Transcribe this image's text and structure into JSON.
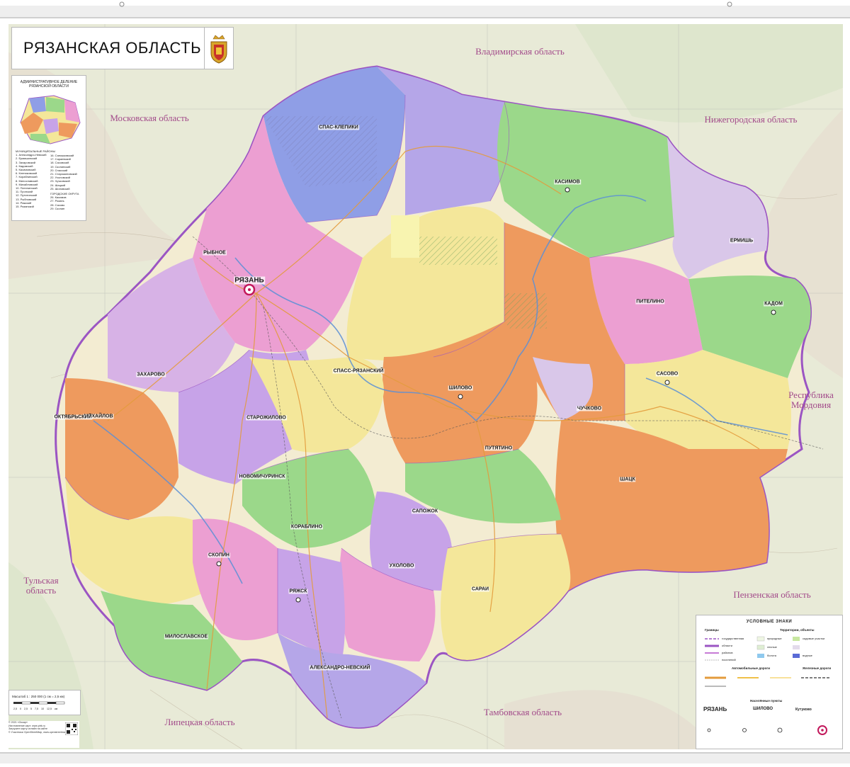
{
  "title": "РЯЗАНСКАЯ ОБЛАСТЬ",
  "inset": {
    "heading": "АДМИНИСТРАТИВНОЕ ДЕЛЕНИЕ РЯЗАНСКОЙ ОБЛАСТИ",
    "col1_header": "МУНИЦИПАЛЬНЫЕ РАЙОНЫ",
    "col1": [
      "1. Александро-Невский",
      "2. Ермишинский",
      "3. Захаровский",
      "4. Кадомский",
      "5. Касимовский",
      "6. Клепиковский",
      "7. Кораблинский",
      "8. Милославский",
      "9. Михайловский",
      "10. Пителинский",
      "11. Пронский",
      "12. Путятинский",
      "13. Рыбновский",
      "14. Ряжский",
      "15. Рязанский"
    ],
    "col2": [
      "16. Сапожковский",
      "17. Сараевский",
      "18. Сасовский",
      "19. Скопинский",
      "20. Спасский",
      "21. Старожиловский",
      "22. Ухоловский",
      "23. Чучковский",
      "24. Шацкий",
      "25. Шиловский"
    ],
    "col2_header": "ГОРОДСКИЕ ОКРУГА",
    "col2b": [
      "26. Касимов",
      "27. Рязань",
      "28. Сасово",
      "29. Скопин"
    ]
  },
  "neighbors": [
    {
      "name": "Владимирская область"
    },
    {
      "name": "Московская область"
    },
    {
      "name": "Нижегородская область"
    },
    {
      "name": "Республика Мордовия"
    },
    {
      "name": "Тульская область"
    },
    {
      "name": "Пензенская область"
    },
    {
      "name": "Тамбовская область"
    },
    {
      "name": "Липецкая область"
    }
  ],
  "cities": [
    {
      "name": "РЯЗАНЬ",
      "capital": true
    },
    {
      "name": "КАСИМОВ"
    },
    {
      "name": "САСОВО"
    },
    {
      "name": "СКОПИН"
    },
    {
      "name": "РЫБНОЕ"
    },
    {
      "name": "СПАСС-РЯЗАНСКИЙ"
    },
    {
      "name": "ШИЛОВО"
    },
    {
      "name": "РЯЖСК"
    },
    {
      "name": "НОВОМИЧУРИНСК"
    },
    {
      "name": "КОРАБЛИНО"
    },
    {
      "name": "САПОЖОК"
    },
    {
      "name": "САРАИ"
    },
    {
      "name": "ШАЦК"
    },
    {
      "name": "МИХАЙЛОВ"
    },
    {
      "name": "СПАС-КЛЕПИКИ"
    },
    {
      "name": "КАДОМ"
    },
    {
      "name": "ЧУЧКОВО"
    },
    {
      "name": "ПУТЯТИНО"
    },
    {
      "name": "УХОЛОВО"
    },
    {
      "name": "СТАРОЖИЛОВО"
    },
    {
      "name": "МИЛОСЛАВСКОЕ"
    },
    {
      "name": "АЛЕКСАНДРО-НЕВСКИЙ"
    },
    {
      "name": "ЗАХАРОВО"
    },
    {
      "name": "ПИТЕЛИНО"
    },
    {
      "name": "ЕРМИШЬ"
    },
    {
      "name": "ОКТЯБРЬСКИЙ"
    }
  ],
  "legend": {
    "title": "УСЛОВНЫЕ ЗНАКИ",
    "borders": "Границы",
    "territories": "Территории, объекты",
    "roads": "Автомобильные дороги",
    "rail": "Железные дороги",
    "settlements": "Населённые пункты",
    "sample_big": "РЯЗАНЬ",
    "sample_mid": "ШИЛОВО",
    "sample_small": "Кутуково",
    "items_left": [
      "государственная",
      "области",
      "районов",
      "поселений"
    ],
    "items_right": [
      "природные",
      "лесные",
      "садовые участки",
      "водные",
      "болота"
    ]
  },
  "scale": {
    "text": "Масштаб 1 : 250 000   (1 см = 2,5 км)",
    "ticks": [
      "2,5",
      "0",
      "2,5",
      "5",
      "7,5",
      "10",
      "12,5 км"
    ]
  },
  "footer": [
    "© 2021 «Оскар»",
    "Изготовление карт: www.ptrk.ru",
    "Загрузите карту онлайн на сайте",
    "© Участники OpenStreetMap, www.openstreetmap.org"
  ],
  "colors": {
    "purple": "#c7a3e8",
    "orange": "#ee9a5e",
    "green": "#9bd88a",
    "yellow": "#f4e79a",
    "pink": "#ec9fd2",
    "lilac": "#b5a6e8",
    "blue": "#8f9ee6",
    "lightgreen": "#c6e7a6",
    "neighbor": "#e8ead7",
    "border": "#9b55c3"
  }
}
